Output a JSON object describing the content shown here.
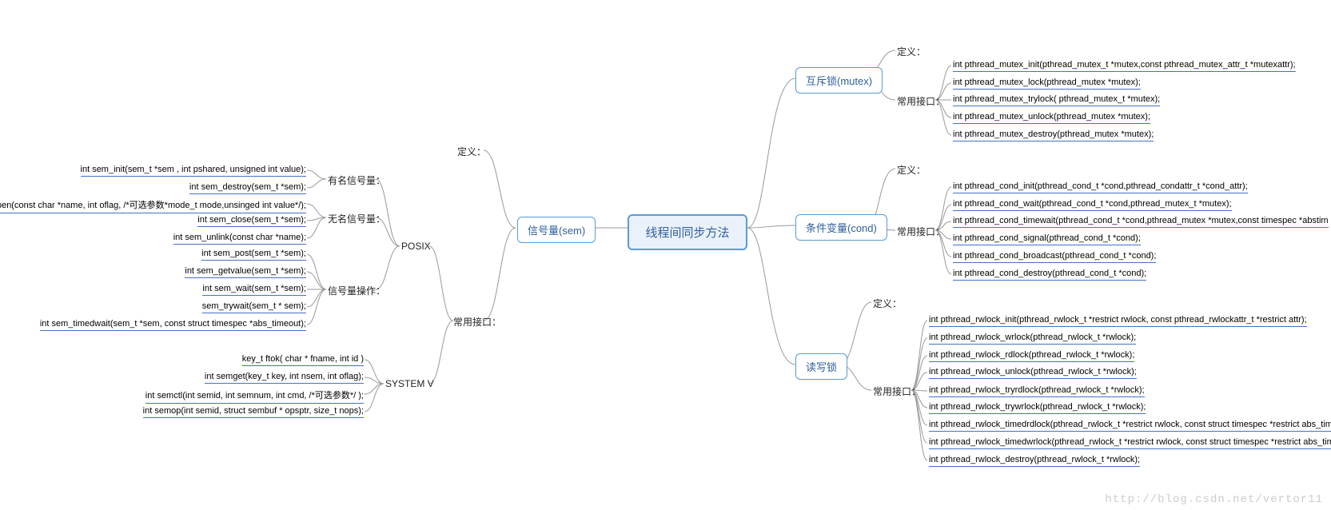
{
  "root": "线程间同步方法",
  "left": {
    "sem": "信号量(sem)",
    "def": "定义：",
    "iface": "常用接口：",
    "posix": "POSIX",
    "sysv": "SYSTEM V",
    "named": "有名信号量：",
    "unnamed": "无名信号量：",
    "ops": "信号量操作：",
    "named_fn": [
      "int sem_init(sem_t *sem , int pshared, unsigned int value);",
      "int sem_destroy(sem_t *sem);"
    ],
    "unnamed_fn": [
      "sem_t *sem sem_open(const char *name, int oflag, /*可选参数*mode_t mode,unsinged int value*/);",
      "int sem_close(sem_t *sem);",
      "int sem_unlink(const char *name);"
    ],
    "ops_fn": [
      "int sem_post(sem_t *sem);",
      "int sem_getvalue(sem_t *sem);",
      "int sem_wait(sem_t *sem);",
      "sem_trywait(sem_t * sem);",
      "int sem_timedwait(sem_t *sem, const struct timespec *abs_timeout);"
    ],
    "sysv_fn": [
      "key_t ftok( char * fname, int id )",
      "int semget(key_t key, int nsem, int oflag);",
      "int semctl(int semid, int semnum, int cmd, /*可选参数*/ );",
      "int semop(int semid, struct sembuf * opsptr, size_t nops);"
    ]
  },
  "right": {
    "mutex": "互斥锁(mutex)",
    "cond": "条件变量(cond)",
    "rwlock": "读写锁",
    "def": "定义：",
    "iface": "常用接口：",
    "mutex_fn": [
      "int pthread_mutex_init(pthread_mutex_t *mutex,const pthread_mutex_attr_t *mutexattr);",
      "int pthread_mutex_lock(pthread_mutex *mutex);",
      "int pthread_mutex_trylock( pthread_mutex_t *mutex);",
      "int pthread_mutex_unlock(pthread_mutex *mutex);",
      "int pthread_mutex_destroy(pthread_mutex *mutex);"
    ],
    "cond_fn": [
      "int pthread_cond_init(pthread_cond_t *cond,pthread_condattr_t *cond_attr);",
      "int pthread_cond_wait(pthread_cond_t *cond,pthread_mutex_t *mutex);",
      "int pthread_cond_timewait(pthread_cond_t *cond,pthread_mutex *mutex,const timespec *abstim",
      "int pthread_cond_signal(pthread_cond_t *cond);",
      "int pthread_cond_broadcast(pthread_cond_t *cond);",
      "int pthread_cond_destroy(pthread_cond_t *cond);"
    ],
    "rwlock_fn": [
      "int pthread_rwlock_init(pthread_rwlock_t *restrict rwlock, const pthread_rwlockattr_t *restrict attr);",
      "int pthread_rwlock_wrlock(pthread_rwlock_t *rwlock);",
      "int pthread_rwlock_rdlock(pthread_rwlock_t *rwlock);",
      "int pthread_rwlock_unlock(pthread_rwlock_t *rwlock);",
      "int pthread_rwlock_tryrdlock(pthread_rwlock_t *rwlock);",
      "int pthread_rwlock_trywrlock(pthread_rwlock_t *rwlock);",
      "int pthread_rwlock_timedrdlock(pthread_rwlock_t *restrict rwlock, const struct timespec *restrict abs_timeout);",
      "int pthread_rwlock_timedwrlock(pthread_rwlock_t *restrict rwlock, const struct timespec *restrict abs_timeout);",
      "int pthread_rwlock_destroy(pthread_rwlock_t *rwlock);"
    ]
  },
  "watermark": "http://blog.csdn.net/vertor11"
}
